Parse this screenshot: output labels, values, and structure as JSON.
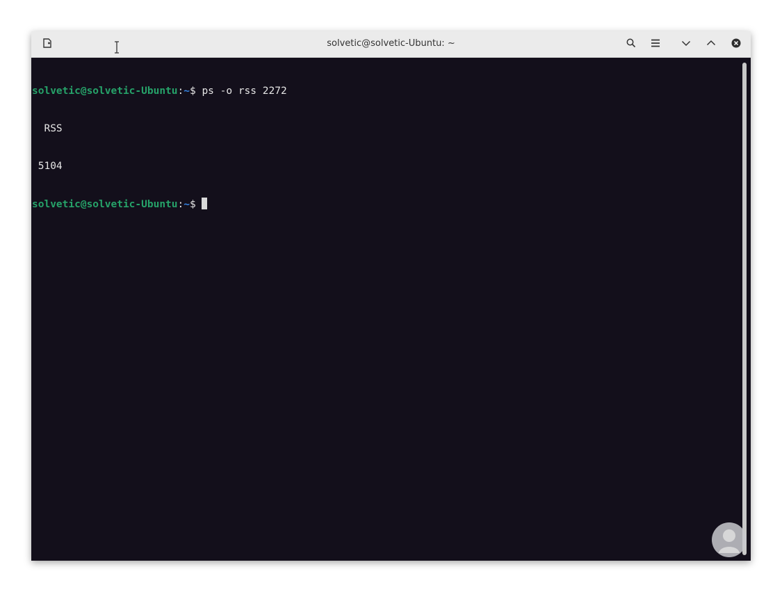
{
  "window": {
    "title": "solvetic@solvetic-Ubuntu: ~",
    "buttons": {
      "new_tab_icon": "new-tab-icon",
      "search_icon": "search-icon",
      "menu_icon": "hamburger-menu-icon",
      "minimize_icon": "chevron-down-icon",
      "maximize_icon": "chevron-up-icon",
      "close_icon": "close-icon"
    }
  },
  "terminal": {
    "lines": [
      {
        "user": "solvetic@solvetic-Ubuntu",
        "sep": ":",
        "path": "~",
        "symbol": "$ ",
        "command": "ps -o rss 2272"
      },
      {
        "output": "  RSS"
      },
      {
        "output": " 5104"
      },
      {
        "user": "solvetic@solvetic-Ubuntu",
        "sep": ":",
        "path": "~",
        "symbol": "$ ",
        "command": ""
      }
    ]
  },
  "colors": {
    "terminal_bg": "#130f1b",
    "prompt_user": "#26a269",
    "prompt_path": "#3584e4",
    "text": "#e6e6e6",
    "titlebar": "#ebebeb"
  }
}
